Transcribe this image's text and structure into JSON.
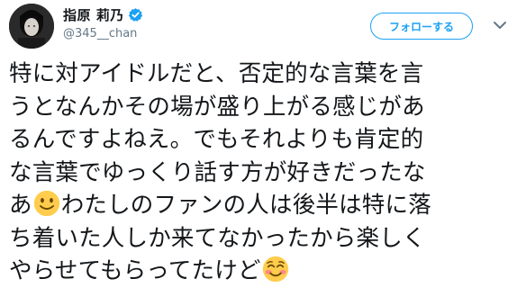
{
  "user": {
    "display_name": "指原 莉乃",
    "handle": "@345__chan",
    "verified_icon": "verified-badge-icon",
    "avatar_icon": "profile-avatar"
  },
  "follow_button": {
    "label": "フォローする"
  },
  "tweet": {
    "lines": [
      "特に対アイドルだと、否定的な言葉を言",
      "うとなんかその場が盛り上がる感じがあ",
      "るんですよねえ。でもそれよりも肯定的",
      "な言葉でゆっくり話す方が好きだったな"
    ],
    "line5_before": "あ",
    "line5_after": "わたしのファンの人は後半は特に落",
    "line6": "ち着いた人しか来てなかったから楽しく",
    "line7_before": "やらせてもらってたけど",
    "emoji1_icon": "slightly-smiling-face-emoji",
    "emoji2_icon": "smiling-face-with-blush-emoji"
  },
  "colors": {
    "brand_blue": "#1da1f2",
    "text_primary": "#14171a",
    "text_secondary": "#657786",
    "emoji_yellow": "#ffcc4d"
  }
}
